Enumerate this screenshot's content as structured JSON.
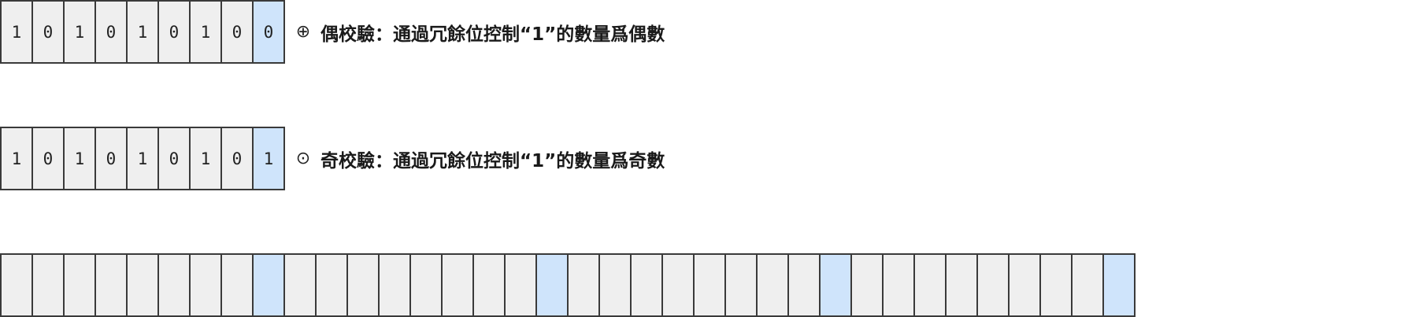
{
  "even_row": {
    "bits": [
      "1",
      "0",
      "1",
      "0",
      "1",
      "0",
      "1",
      "0",
      "0"
    ],
    "parity_positions": [
      8
    ],
    "operator": "⊕",
    "caption": "偶校驗：通過冗餘位控制“1”的數量爲偶數"
  },
  "odd_row": {
    "bits": [
      "1",
      "0",
      "1",
      "0",
      "1",
      "0",
      "1",
      "0",
      "1"
    ],
    "parity_positions": [
      8
    ],
    "operator": "⊙",
    "caption": "奇校驗：通過冗餘位控制“1”的數量爲奇數"
  },
  "long_row": {
    "cell_count": 36,
    "parity_positions": [
      8,
      17,
      26,
      35
    ]
  },
  "colors": {
    "cell_fill": "#efefef",
    "parity_fill": "#cfe4fb",
    "border": "#3a3a3a",
    "text": "#222222"
  }
}
